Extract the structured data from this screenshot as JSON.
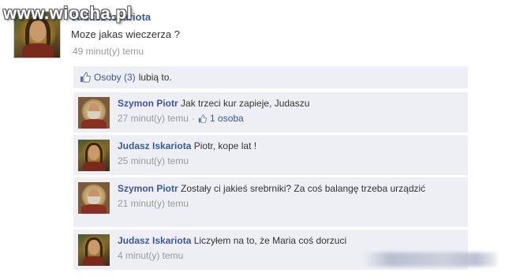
{
  "watermark": "www.wiocha.pl",
  "post": {
    "author": "Judasz Iskariota",
    "text": "Moze jakas wieczerza ?",
    "time": "49 minut(y) temu"
  },
  "likes": {
    "link": "Osoby (3)",
    "suffix": "lubią to."
  },
  "comments": [
    {
      "author": "Szymon Piotr",
      "text": "Jak trzeci kur zapieje, Judaszu",
      "time": "27 minut(y) temu",
      "separator": "·",
      "likes": "1 osoba"
    },
    {
      "author": "Judasz Iskariota",
      "text": "Piotr, kope lat !",
      "time": "25 minut(y) temu"
    },
    {
      "author": "Szymon Piotr",
      "text": "Zostały ci jakieś srebrniki? Za coś balangę trzeba urządzić",
      "time": "21 minut(y) temu"
    },
    {
      "author": "Judasz Iskariota",
      "text": "Liczyłem na to, że Maria coś dorzuci",
      "time": "4 minut(y) temu"
    }
  ],
  "icons": {
    "like": "thumbs-up-icon"
  },
  "colors": {
    "link": "#3b5998",
    "comment_bg": "#edeff4",
    "meta": "#999999"
  }
}
